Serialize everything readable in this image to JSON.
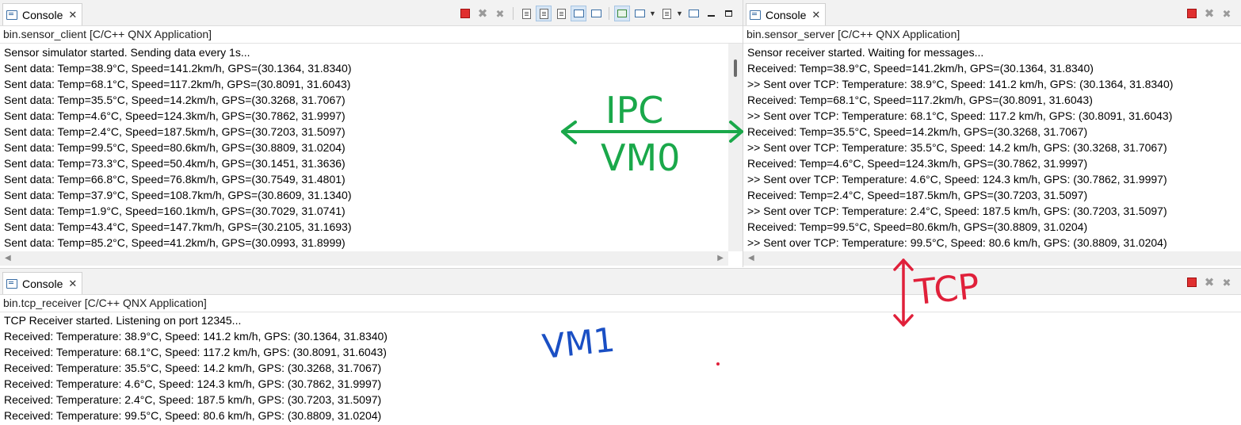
{
  "panes": {
    "client": {
      "tab_label": "Console",
      "tab_close": "✕",
      "title": "bin.sensor_client [C/C++ QNX Application]",
      "lines": [
        "Sensor simulator started. Sending data every 1s...",
        "Sent data: Temp=38.9°C, Speed=141.2km/h, GPS=(30.1364, 31.8340)",
        "Sent data: Temp=68.1°C, Speed=117.2km/h, GPS=(30.8091, 31.6043)",
        "Sent data: Temp=35.5°C, Speed=14.2km/h, GPS=(30.3268, 31.7067)",
        "Sent data: Temp=4.6°C, Speed=124.3km/h, GPS=(30.7862, 31.9997)",
        "Sent data: Temp=2.4°C, Speed=187.5km/h, GPS=(30.7203, 31.5097)",
        "Sent data: Temp=99.5°C, Speed=80.6km/h, GPS=(30.8809, 31.0204)",
        "Sent data: Temp=73.3°C, Speed=50.4km/h, GPS=(30.1451, 31.3636)",
        "Sent data: Temp=66.8°C, Speed=76.8km/h, GPS=(30.7549, 31.4801)",
        "Sent data: Temp=37.9°C, Speed=108.7km/h, GPS=(30.8609, 31.1340)",
        "Sent data: Temp=1.9°C, Speed=160.1km/h, GPS=(30.7029, 31.0741)",
        "Sent data: Temp=43.4°C, Speed=147.7km/h, GPS=(30.2105, 31.1693)",
        "Sent data: Temp=85.2°C, Speed=41.2km/h, GPS=(30.0993, 31.8999)"
      ]
    },
    "server": {
      "tab_label": "Console",
      "tab_close": "✕",
      "title": "bin.sensor_server [C/C++ QNX Application]",
      "lines": [
        "Sensor receiver started. Waiting for messages...",
        "Received: Temp=38.9°C, Speed=141.2km/h, GPS=(30.1364, 31.8340)",
        ">> Sent over TCP: Temperature: 38.9°C, Speed: 141.2 km/h, GPS: (30.1364, 31.8340)",
        "Received: Temp=68.1°C, Speed=117.2km/h, GPS=(30.8091, 31.6043)",
        ">> Sent over TCP: Temperature: 68.1°C, Speed: 117.2 km/h, GPS: (30.8091, 31.6043)",
        "Received: Temp=35.5°C, Speed=14.2km/h, GPS=(30.3268, 31.7067)",
        ">> Sent over TCP: Temperature: 35.5°C, Speed: 14.2 km/h, GPS: (30.3268, 31.7067)",
        "Received: Temp=4.6°C, Speed=124.3km/h, GPS=(30.7862, 31.9997)",
        ">> Sent over TCP: Temperature: 4.6°C, Speed: 124.3 km/h, GPS: (30.7862, 31.9997)",
        "Received: Temp=2.4°C, Speed=187.5km/h, GPS=(30.7203, 31.5097)",
        ">> Sent over TCP: Temperature: 2.4°C, Speed: 187.5 km/h, GPS: (30.7203, 31.5097)",
        "Received: Temp=99.5°C, Speed=80.6km/h, GPS=(30.8809, 31.0204)",
        ">> Sent over TCP: Temperature: 99.5°C, Speed: 80.6 km/h, GPS: (30.8809, 31.0204)"
      ]
    },
    "receiver": {
      "tab_label": "Console",
      "tab_close": "✕",
      "title": "bin.tcp_receiver [C/C++ QNX Application]",
      "lines": [
        "TCP Receiver started. Listening on port 12345...",
        "Received: Temperature: 38.9°C, Speed: 141.2 km/h, GPS: (30.1364, 31.8340)",
        "Received: Temperature: 68.1°C, Speed: 117.2 km/h, GPS: (30.8091, 31.6043)",
        "Received: Temperature: 35.5°C, Speed: 14.2 km/h, GPS: (30.3268, 31.7067)",
        "Received: Temperature: 4.6°C, Speed: 124.3 km/h, GPS: (30.7862, 31.9997)",
        "Received: Temperature: 2.4°C, Speed: 187.5 km/h, GPS: (30.7203, 31.5097)",
        "Received: Temperature: 99.5°C, Speed: 80.6 km/h, GPS: (30.8809, 31.0204)"
      ]
    }
  },
  "scroll_arrows": {
    "left": "◀",
    "right": "▶"
  },
  "annotations": {
    "ipc_label": "IPC",
    "vm0_label": "VM0",
    "tcp_label": "TCP",
    "vm1_label": "VM1",
    "green": "#1aa84a",
    "red": "#e0203a",
    "blue": "#1a4fc4"
  },
  "icons": {
    "toolbar_client": [
      "terminate-icon",
      "remove-launch-icon",
      "remove-all-terminated-icon",
      "clear-console-icon",
      "scroll-lock-icon",
      "word-wrap-icon",
      "show-on-stdout-icon",
      "show-on-stderr-icon",
      "pin-console-icon",
      "display-selected-console-icon",
      "open-console-icon",
      "minimize-icon",
      "maximize-icon"
    ],
    "toolbar_server": [
      "terminate-icon",
      "remove-launch-icon",
      "remove-all-terminated-icon"
    ],
    "toolbar_receiver": [
      "terminate-icon",
      "remove-launch-icon",
      "remove-all-terminated-icon"
    ]
  }
}
